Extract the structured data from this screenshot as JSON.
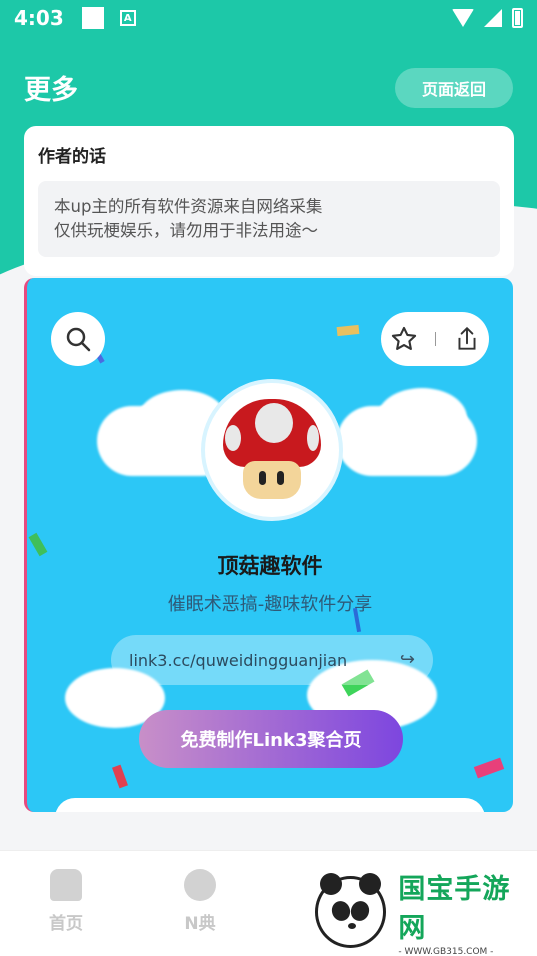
{
  "status_bar": {
    "time": "4:03",
    "a_icon": "A"
  },
  "header": {
    "title": "更多",
    "back_label": "页面返回"
  },
  "author_card": {
    "title": "作者的话",
    "line1": "本up主的所有软件资源来自网络采集",
    "line2": "仅供玩梗娱乐，请勿用于非法用途～"
  },
  "preview": {
    "name": "顶菇趣软件",
    "subtitle": "催眠术恶搞-趣味软件分享",
    "link": "link3.cc/quweidingguanjian",
    "make_button": "免费制作Link3聚合页"
  },
  "nav": {
    "items": [
      {
        "label": "首页",
        "icon": "home-icon"
      },
      {
        "label": "N典",
        "icon": "compass-icon"
      }
    ]
  },
  "watermark": {
    "title": "国宝手游网",
    "url": "- WWW.GB315.COM -"
  },
  "colors": {
    "teal": "#1dc8a8",
    "sky": "#2cc7f6",
    "mushroom_red": "#c8191e"
  }
}
